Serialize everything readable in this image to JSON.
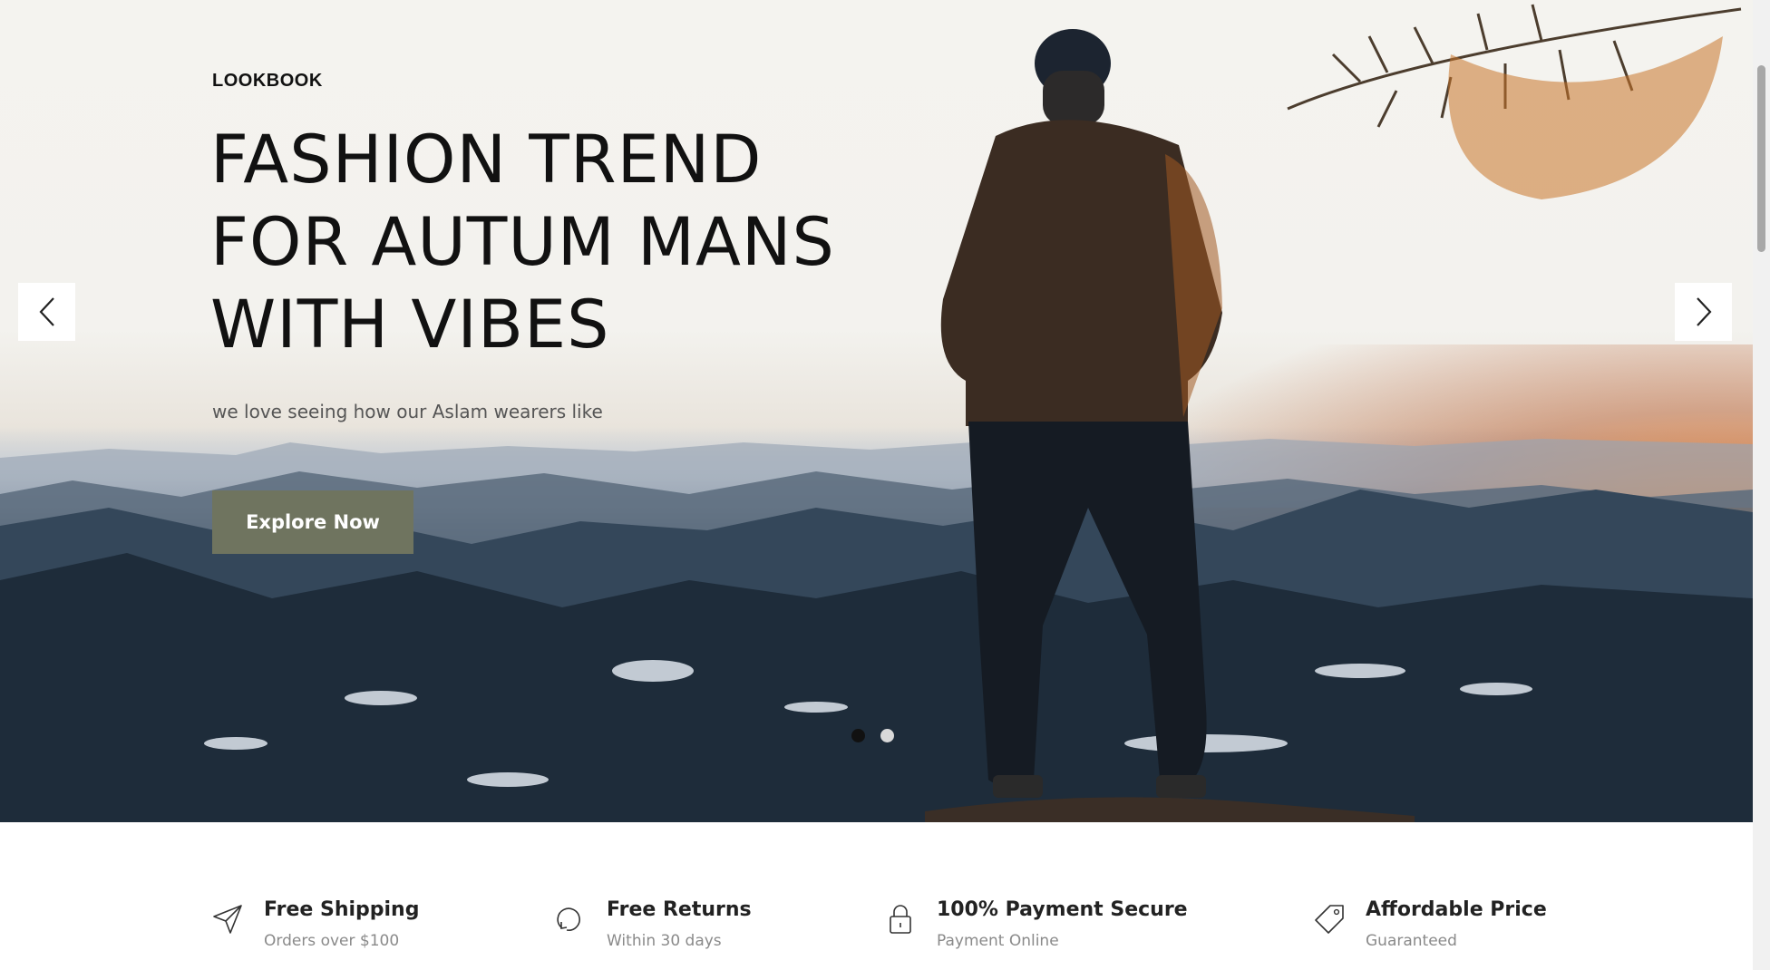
{
  "hero": {
    "eyebrow": "LOOKBOOK",
    "headline_lines": [
      "FASHION TREND",
      "FOR AUTUM MANS",
      "WITH VIBES"
    ],
    "subtext": "we love seeing how our Aslam wearers like",
    "cta_label": "Explore Now",
    "cta_color": "#6f745f",
    "prev_icon": "chevron-left-icon",
    "next_icon": "chevron-right-icon",
    "slides_total": 2,
    "active_slide": 1
  },
  "features": [
    {
      "icon": "send-icon",
      "title": "Free Shipping",
      "subtitle": "Orders over $100"
    },
    {
      "icon": "refresh-icon",
      "title": "Free Returns",
      "subtitle": "Within 30 days"
    },
    {
      "icon": "lock-icon",
      "title": "100% Payment Secure",
      "subtitle": "Payment Online"
    },
    {
      "icon": "tag-icon",
      "title": "Affordable Price",
      "subtitle": "Guaranteed"
    }
  ]
}
